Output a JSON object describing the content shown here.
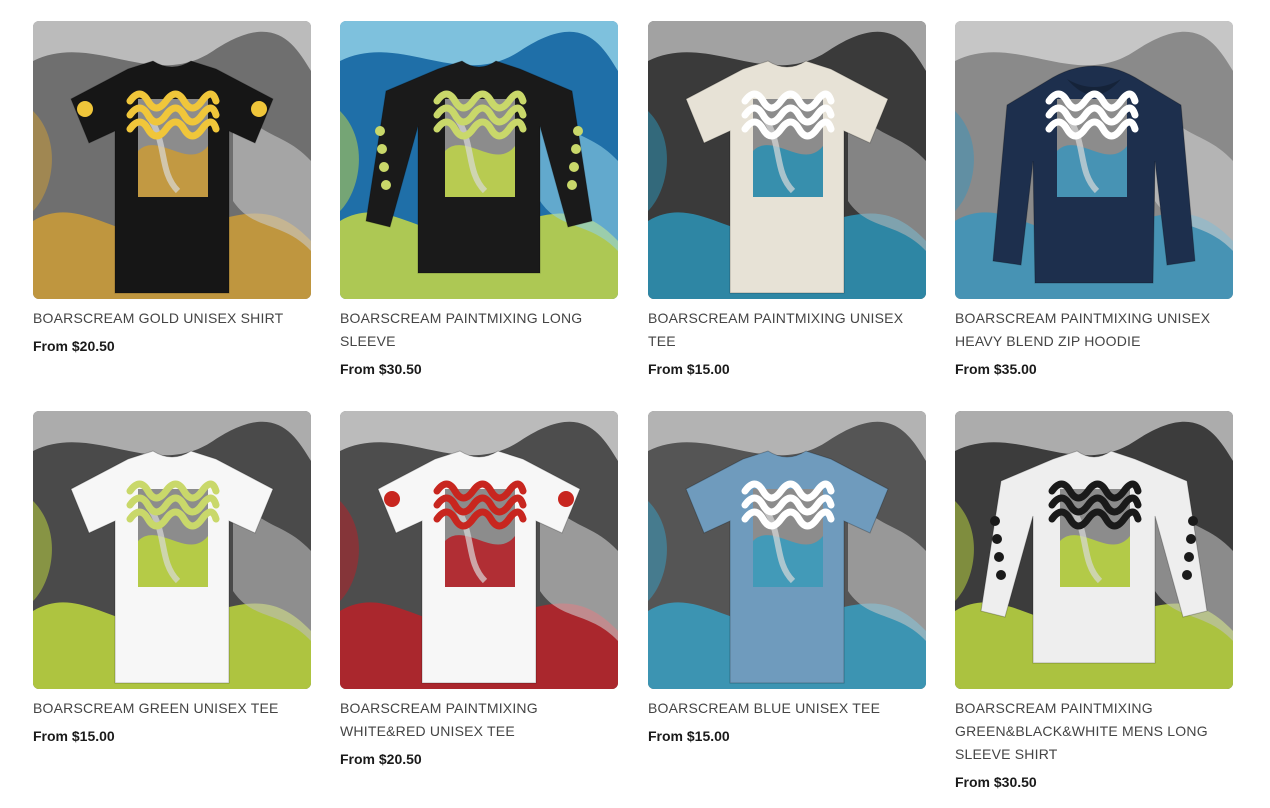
{
  "products": [
    {
      "title": "BOARSCREAM GOLD UNISEX SHIRT",
      "price": "From $20.50",
      "garment": "tee",
      "garment_color": "#161616",
      "print_color": "#f0c63a",
      "sleeve_prints": true,
      "bg": [
        "#6f6f6f",
        "#c9c9c9",
        "#c89a3a"
      ]
    },
    {
      "title": "BOARSCREAM PAINTMIXING LONG SLEEVE",
      "price": "From $30.50",
      "garment": "longsleeve",
      "garment_color": "#1a1a1a",
      "print_color": "#c9d86a",
      "sleeve_prints": true,
      "bg": [
        "#1f6fa8",
        "#8fd0e6",
        "#bcd24a"
      ]
    },
    {
      "title": "BOARSCREAM PAINTMIXING UNISEX TEE",
      "price": "From $15.00",
      "garment": "tee",
      "garment_color": "#e7e2d6",
      "print_color": "#ffffff",
      "sleeve_prints": false,
      "bg": [
        "#3a3a3a",
        "#b5b5b5",
        "#2e8fb0"
      ]
    },
    {
      "title": "BOARSCREAM PAINTMIXING UNISEX HEAVY BLEND ZIP HOODIE",
      "price": "From $35.00",
      "garment": "hoodie",
      "garment_color": "#1d2f4d",
      "print_color": "#ffffff",
      "sleeve_prints": false,
      "bg": [
        "#8a8a8a",
        "#d0d0d0",
        "#3f93b8"
      ]
    },
    {
      "title": "BOARSCREAM GREEN UNISEX TEE",
      "price": "From $15.00",
      "garment": "tee",
      "garment_color": "#f7f7f7",
      "print_color": "#c9d86a",
      "sleeve_prints": false,
      "bg": [
        "#4a4a4a",
        "#bdbdbd",
        "#b9d23f"
      ]
    },
    {
      "title": "BOARSCREAM PAINTMIXING WHITE&RED UNISEX TEE",
      "price": "From $20.50",
      "garment": "tee",
      "garment_color": "#f7f7f7",
      "print_color": "#c8261f",
      "sleeve_prints": true,
      "bg": [
        "#4d4d4d",
        "#cfcfcf",
        "#b5232a"
      ]
    },
    {
      "title": "BOARSCREAM BLUE UNISEX TEE",
      "price": "From $15.00",
      "garment": "tee",
      "garment_color": "#6f9bbd",
      "print_color": "#ffffff",
      "sleeve_prints": false,
      "bg": [
        "#555555",
        "#c4c4c4",
        "#3a9bbd"
      ]
    },
    {
      "title": "BOARSCREAM PAINTMIXING GREEN&BLACK&WHITE MENS LONG SLEEVE SHIRT",
      "price": "From $30.50",
      "garment": "longsleeve",
      "garment_color": "#eeeeee",
      "print_color": "#1a1a1a",
      "sleeve_prints": true,
      "bg": [
        "#3c3c3c",
        "#bfbfbf",
        "#b7d040"
      ]
    }
  ]
}
